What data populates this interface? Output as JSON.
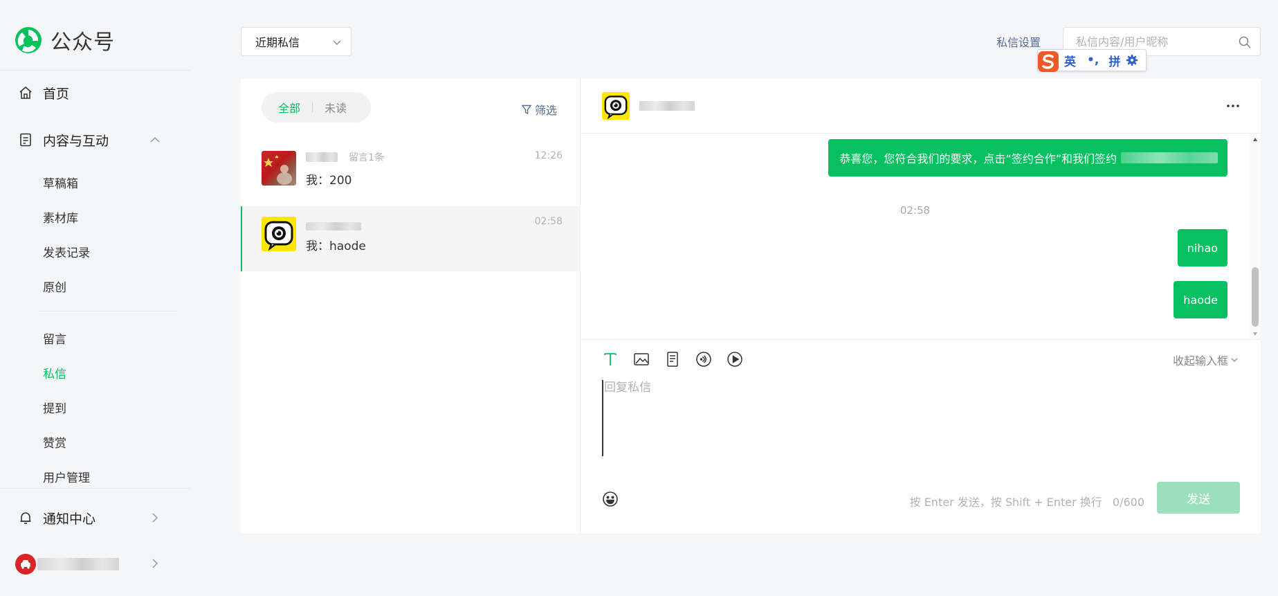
{
  "app": {
    "title": "公众号",
    "accent_color": "#07c160",
    "link_color": "#576b95"
  },
  "sidebar": {
    "home_label": "首页",
    "content_section_label": "内容与互动",
    "content_items": [
      "草稿箱",
      "素材库",
      "发表记录",
      "原创"
    ],
    "interaction_items": [
      "留言",
      "私信",
      "提到",
      "赞赏",
      "用户管理"
    ],
    "active_item": "私信",
    "notification_label": "通知中心"
  },
  "topbar": {
    "filter_value": "近期私信",
    "dm_settings_label": "私信设置",
    "search_placeholder": "私信内容/用户昵称"
  },
  "ime": {
    "lang": "英",
    "punct": "•,",
    "mode": "拼"
  },
  "conversation_list": {
    "tab_all": "全部",
    "tab_unread": "未读",
    "filter_label": "筛选",
    "items": [
      {
        "comment_tag": "留言1条",
        "time": "12:26",
        "preview": "我：200",
        "avatar": "flag-avatar-icon"
      },
      {
        "comment_tag": "",
        "time": "02:58",
        "preview": "我：haode",
        "avatar": "camera-avatar-icon"
      }
    ]
  },
  "chat": {
    "messages": [
      {
        "text": "恭喜您，您符合我们的要求，点击“签约合作”和我们签约"
      },
      {
        "timestamp": "02:58"
      },
      {
        "text": "nihao"
      },
      {
        "text": "haode"
      }
    ]
  },
  "composer": {
    "collapse_label": "收起输入框",
    "placeholder": "回复私信",
    "hint": "按 Enter 发送，按 Shift + Enter 换行",
    "counter": "0/600",
    "send_label": "发送",
    "tools": [
      "text-icon",
      "image-icon",
      "document-icon",
      "audio-icon",
      "video-icon"
    ]
  }
}
